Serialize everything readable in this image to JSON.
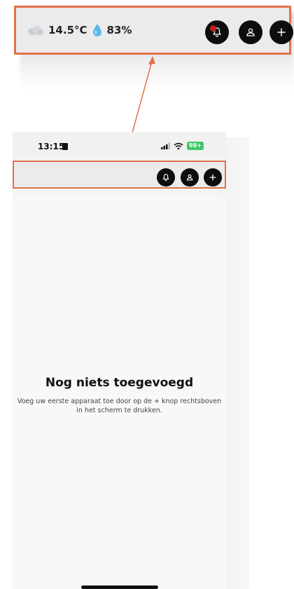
{
  "zoom_callout": {
    "temperature": "14.5°C",
    "humidity": "83%",
    "weather_icon": "cloud-icon",
    "humidity_icon": "water-drop-icon",
    "notification_indicator_color": "#c4201b"
  },
  "status_bar": {
    "time": "13:15",
    "battery": "98+"
  },
  "header": {
    "buttons": [
      "bell-icon",
      "user-icon",
      "plus-icon"
    ]
  },
  "empty_state": {
    "title": "Nog niets toegevoegd",
    "description_line1": "Voeg uw eerste apparaat toe door op de + knop rechtsboven",
    "description_line2": "in het scherm te drukken."
  },
  "colors": {
    "highlight": "#e2714a",
    "button": "#0d0d0d",
    "battery": "#3ec96a"
  }
}
